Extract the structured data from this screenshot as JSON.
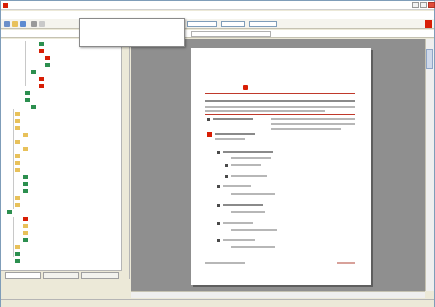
{
  "window": {
    "title": ""
  },
  "menubar": {
    "items": [
      {
        "label": ""
      },
      {
        "label": ""
      },
      {
        "label": ""
      },
      {
        "label": ""
      },
      {
        "label": ""
      }
    ]
  },
  "address": {
    "label": ""
  },
  "dropdown": {
    "items": [
      {
        "label": ""
      },
      {
        "label": ""
      },
      {
        "label": ""
      },
      {
        "label": ""
      },
      {
        "label": ""
      },
      {
        "label": ""
      }
    ]
  },
  "sidebar": {
    "tree": [
      {
        "label": ""
      },
      {
        "label": ""
      },
      {
        "label": ""
      },
      {
        "label": ""
      },
      {
        "label": ""
      },
      {
        "label": ""
      },
      {
        "label": ""
      },
      {
        "label": ""
      },
      {
        "label": ""
      },
      {
        "label": ""
      },
      {
        "label": ""
      },
      {
        "label": ""
      },
      {
        "label": ""
      },
      {
        "label": ""
      },
      {
        "label": ""
      },
      {
        "label": ""
      },
      {
        "label": ""
      },
      {
        "label": ""
      },
      {
        "label": ""
      },
      {
        "label": ""
      },
      {
        "label": ""
      },
      {
        "label": ""
      },
      {
        "label": ""
      },
      {
        "label": ""
      },
      {
        "label": ""
      },
      {
        "label": ""
      },
      {
        "label": ""
      },
      {
        "label": ""
      },
      {
        "label": ""
      },
      {
        "label": ""
      },
      {
        "label": ""
      },
      {
        "label": ""
      },
      {
        "label": ""
      },
      {
        "label": ""
      }
    ],
    "tabs": [
      {
        "label": ""
      },
      {
        "label": ""
      },
      {
        "label": ""
      }
    ]
  },
  "document": {
    "title": "",
    "subtitle": "",
    "footer_left": "",
    "footer_right": ""
  },
  "status": {
    "left": "",
    "middle": "",
    "right": ""
  },
  "colors": {
    "accent": "#d81e05",
    "selection": "#316ac5",
    "viewer_bg": "#8f8f8f"
  },
  "icons": {
    "app": "pdf-app-icon",
    "folder": "folder-icon",
    "pdf": "pdf-file-icon",
    "doc": "document-icon"
  }
}
